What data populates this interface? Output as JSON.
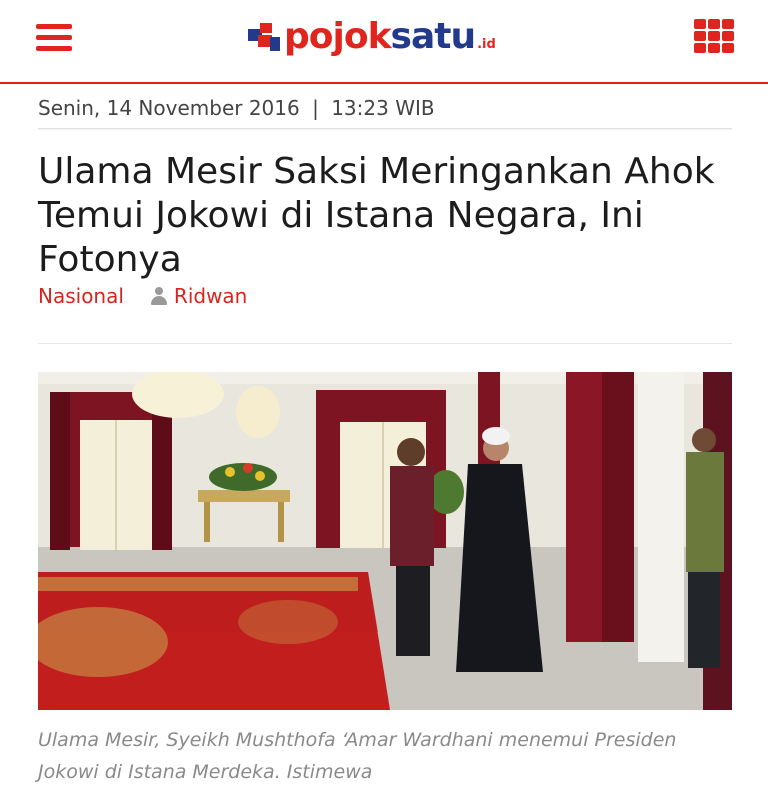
{
  "header": {
    "menu_icon": "hamburger-menu-icon",
    "logo": {
      "part1": "pojok",
      "part2": "satu",
      "tld": ".id"
    },
    "apps_icon": "grid-menu-icon",
    "accent_color": "#e0251e",
    "brand_blue": "#233a8c"
  },
  "article": {
    "date": "Senin, 14 November 2016",
    "separator": "|",
    "time": "13:23 WIB",
    "title": "Ulama Mesir Saksi Meringankan Ahok Temui Jokowi di Istana Negara, Ini Fotonya",
    "category": "Nasional",
    "author_icon": "user-icon",
    "author": "Ridwan",
    "caption": "Ulama Mesir, Syeikh Mushthofa ‘Amar Wardhani menemui Presiden Jokowi di Istana Merdeka. Istimewa"
  }
}
